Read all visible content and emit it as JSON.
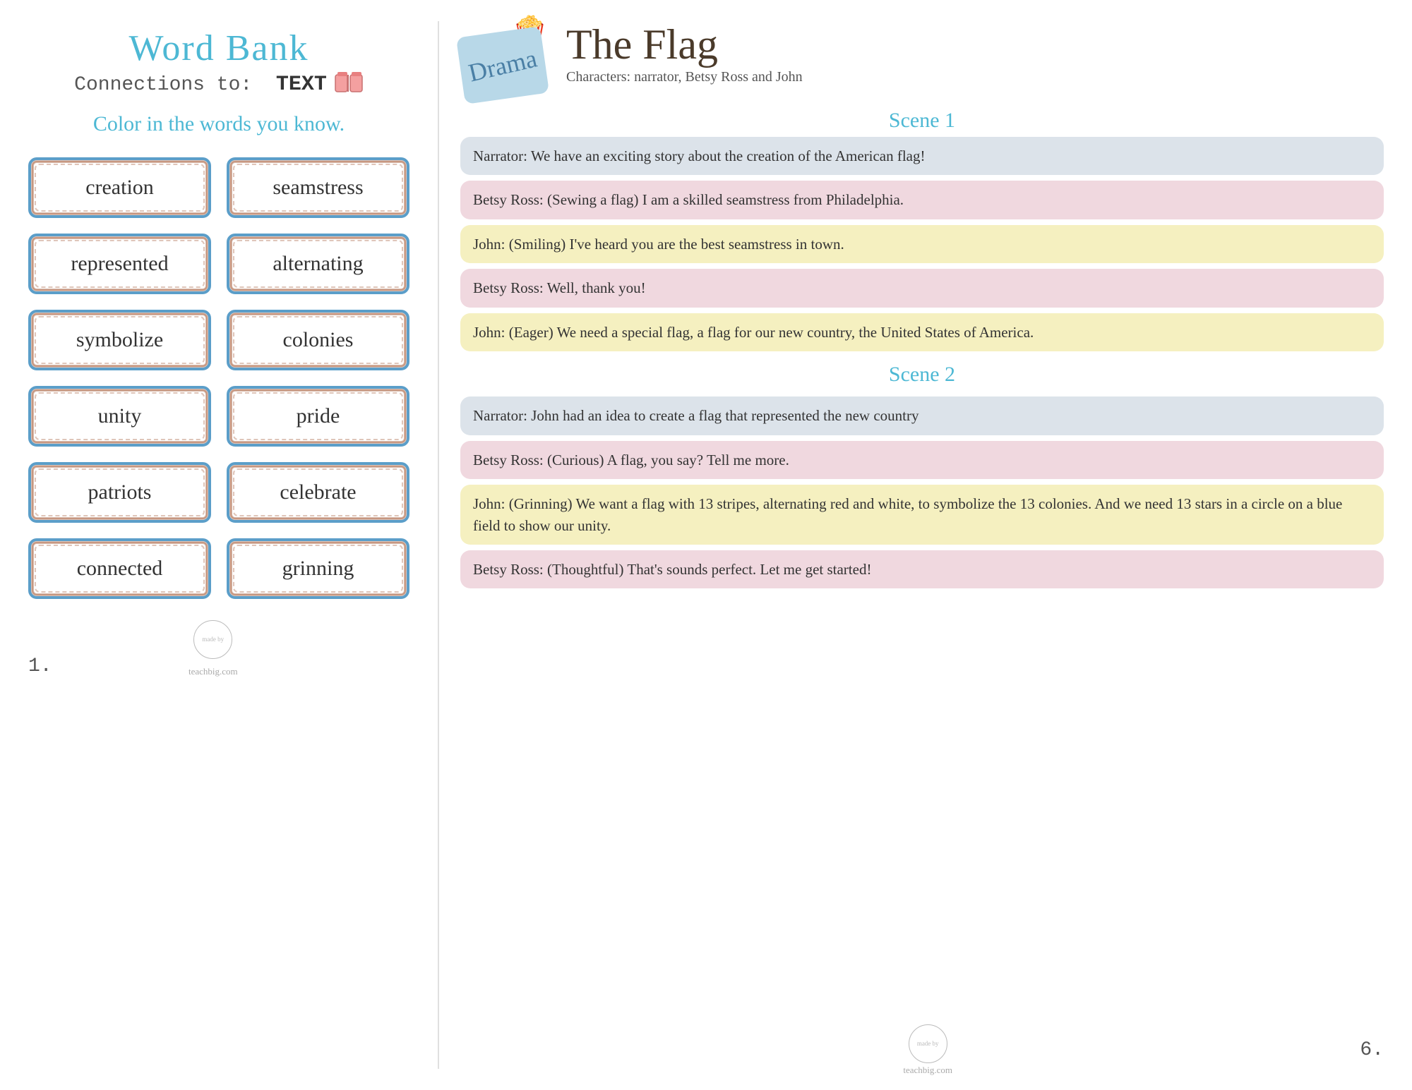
{
  "left": {
    "title": "Word Bank",
    "subtitle": "Connections to:",
    "text_label": "TEXT",
    "instruction": "Color in the words you know.",
    "words": [
      {
        "id": "word-creation",
        "text": "creation"
      },
      {
        "id": "word-seamstress",
        "text": "seamstress"
      },
      {
        "id": "word-represented",
        "text": "represented"
      },
      {
        "id": "word-alternating",
        "text": "alternating"
      },
      {
        "id": "word-symbolize",
        "text": "symbolize"
      },
      {
        "id": "word-colonies",
        "text": "colonies"
      },
      {
        "id": "word-unity",
        "text": "unity"
      },
      {
        "id": "word-pride",
        "text": "pride"
      },
      {
        "id": "word-patriots",
        "text": "patriots"
      },
      {
        "id": "word-celebrate",
        "text": "celebrate"
      },
      {
        "id": "word-connected",
        "text": "connected"
      },
      {
        "id": "word-grinning",
        "text": "grinning"
      }
    ],
    "page_number": "1.",
    "logo_text": "teachbig.com"
  },
  "right": {
    "drama_label": "Drama",
    "title": "The Flag",
    "characters": "Characters: narrator, Betsy Ross and John",
    "scene1_label": "Scene 1",
    "scene2_label": "Scene 2",
    "speeches": [
      {
        "id": "speech-1",
        "style": "gray",
        "text": "Narrator:  We have an exciting story about the creation of the American flag!"
      },
      {
        "id": "speech-2",
        "style": "pink",
        "text": "Betsy Ross: (Sewing a flag) I am a skilled seamstress from Philadelphia."
      },
      {
        "id": "speech-3",
        "style": "yellow",
        "text": "John: (Smiling) I've heard you are the best seamstress in town."
      },
      {
        "id": "speech-4",
        "style": "pink",
        "text": "Betsy Ross: Well, thank you!"
      },
      {
        "id": "speech-5",
        "style": "yellow",
        "text": "John: (Eager) We need a special flag, a flag for our new country, the United States of America."
      },
      {
        "id": "speech-6",
        "style": "gray",
        "text": "Narrator:  John had an idea to create a flag that represented the new country"
      },
      {
        "id": "speech-7",
        "style": "pink",
        "text": "Betsy Ross: (Curious) A flag, you say? Tell me more."
      },
      {
        "id": "speech-8",
        "style": "yellow",
        "text": "John: (Grinning) We want a flag with 13 stripes, alternating red and white, to symbolize the 13 colonies. And we need 13 stars in a circle on a blue field to show our unity."
      },
      {
        "id": "speech-9",
        "style": "pink",
        "text": "Betsy Ross: (Thoughtful) That's sounds perfect. Let me get started!"
      }
    ],
    "page_number": "6.",
    "logo_text": "teachbig.com"
  }
}
